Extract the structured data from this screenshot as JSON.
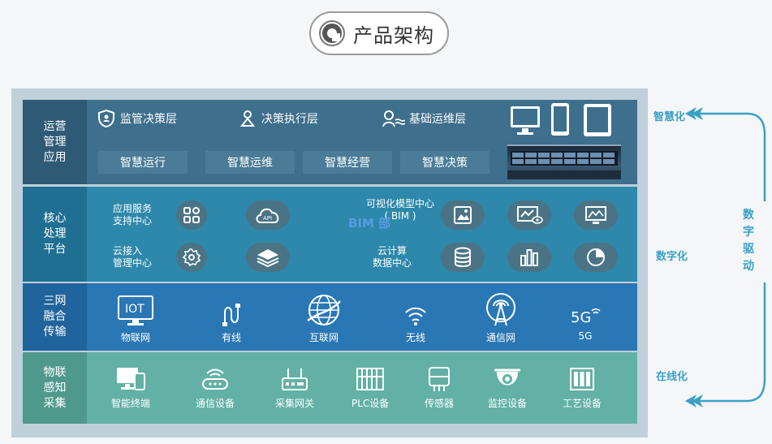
{
  "title": "产品架构",
  "colors": {
    "accent": "#3aa0c8",
    "band1": "#3e6f8c",
    "band2": "#2d88ab",
    "band3": "#2a77b5",
    "band4": "#62b1a4"
  },
  "bands": [
    {
      "label": "运营\n管理\n应用",
      "layers": [
        {
          "label": "监管决策层",
          "icon": "shield-user-icon"
        },
        {
          "label": "决策执行层",
          "icon": "people-icon"
        },
        {
          "label": "基础运维层",
          "icon": "maintenance-icon"
        }
      ],
      "tiles": [
        "智慧运行",
        "智慧运维",
        "智慧经营",
        "智慧决策"
      ]
    },
    {
      "label": "核心\n处理\n平台",
      "texts": [
        "应用服务\n支持中心",
        "云接入\n管理中心",
        "可视化模型中心\n( BIM )",
        "云计算\n数据中心"
      ],
      "watermark": "BIM 部",
      "icons": [
        "apps-icon",
        "api-cloud-icon",
        "gear-icon",
        "layers-icon",
        "image-icon",
        "monitor-eye-icon",
        "dashboard-icon",
        "database-icon",
        "bar-chart-icon",
        "pie-chart-icon"
      ]
    },
    {
      "label": "三网\n融合\n传输",
      "items": [
        {
          "label": "物联网",
          "icon": "iot-icon"
        },
        {
          "label": "有线",
          "icon": "cable-icon"
        },
        {
          "label": "互联网",
          "icon": "globe-icon"
        },
        {
          "label": "无线",
          "icon": "wifi-icon"
        },
        {
          "label": "通信网",
          "icon": "antenna-icon"
        },
        {
          "label": "5G",
          "icon": "5g-icon"
        }
      ],
      "iot_text": "IOT",
      "fiveg_text": "5G"
    },
    {
      "label": "物联\n感知\n采集",
      "items": [
        {
          "label": "智能终端",
          "icon": "terminal-icon"
        },
        {
          "label": "通信设备",
          "icon": "router-icon"
        },
        {
          "label": "采集网关",
          "icon": "gateway-icon"
        },
        {
          "label": "PLC设备",
          "icon": "plc-icon"
        },
        {
          "label": "传感器",
          "icon": "sensor-icon"
        },
        {
          "label": "监控设备",
          "icon": "camera-icon"
        },
        {
          "label": "工艺设备",
          "icon": "process-icon"
        }
      ]
    }
  ],
  "side": {
    "top": "智慧化",
    "mid": "数字化",
    "bottom": "在线化",
    "vertical": "数字驱动"
  }
}
